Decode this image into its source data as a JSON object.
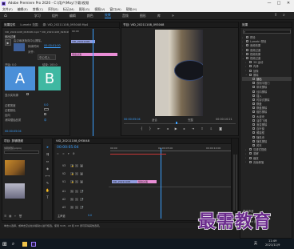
{
  "window": {
    "title": "Adobe Premiere Pro 2020 - C:\\用户\\Moy\\下载\\视频",
    "minimize": "—",
    "maximize": "□",
    "close": "✕"
  },
  "menu": [
    "文件(F)",
    "编辑(E)",
    "剪辑(C)",
    "序列(S)",
    "标记(M)",
    "图形(G)",
    "视图(V)",
    "窗口(W)",
    "帮助(H)"
  ],
  "workspaces": [
    "学习",
    "组件",
    "编辑",
    "颜色",
    "效果",
    "音频",
    "图形",
    "库"
  ],
  "active_workspace": "效果",
  "left_panel": {
    "tabs": [
      "效果控件",
      "Lumetri 范围",
      "源: VID_20211108_093048 Mp4"
    ],
    "clip_name": "VID_20211108_093048.mp4 * VID_20211108_093048",
    "effect_name": "划出过渡",
    "transition_desc": "由边缘逐渐向中心擦除。",
    "duration_label": "持续时间",
    "duration_value": "00:00:01:00",
    "alignment_label": "对齐:",
    "alignment_value": "中心切入",
    "start_label": "开始: 0.0",
    "end_label": "结束: 100.0",
    "a_label": "A",
    "b_label": "B",
    "show_actual": "显示实际源",
    "border_width": "边框宽度",
    "border_color": "边框颜色",
    "reverse": "反向",
    "antialias": "消除锯齿品质",
    "antialias_value": "中",
    "mini_timeline": {
      "clip_name": "VID_20211108",
      "transition": "划出过渡",
      "ruler_time": "00:00"
    },
    "timecode": "00:00:05:04"
  },
  "program": {
    "tab": "节目: VID_20211108_093048",
    "timecode_left": "00:00:05:04",
    "fit": "适合",
    "quality": "完整",
    "timecode_right": "00:00:10:21"
  },
  "effects_panel": {
    "tab": "效果",
    "items": [
      {
        "label": "预设",
        "indent": 0,
        "arrow": "›"
      },
      {
        "label": "Lumetri 预设",
        "indent": 0,
        "arrow": "›"
      },
      {
        "label": "音频效果",
        "indent": 0,
        "arrow": "›"
      },
      {
        "label": "音频过渡",
        "indent": 0,
        "arrow": "›"
      },
      {
        "label": "视频效果",
        "indent": 0,
        "arrow": "›"
      },
      {
        "label": "视频过渡",
        "indent": 0,
        "arrow": "⌄"
      },
      {
        "label": "3D 运动",
        "indent": 1,
        "arrow": "›"
      },
      {
        "label": "内滑",
        "indent": 1,
        "arrow": "›"
      },
      {
        "label": "划像",
        "indent": 1,
        "arrow": "›"
      },
      {
        "label": "擦除",
        "indent": 1,
        "arrow": "⌄"
      },
      {
        "label": "划出",
        "indent": 2,
        "arrow": "",
        "selected": true
      },
      {
        "label": "双侧平推门",
        "indent": 2,
        "arrow": ""
      },
      {
        "label": "带状擦除",
        "indent": 2,
        "arrow": ""
      },
      {
        "label": "径向擦除",
        "indent": 2,
        "arrow": ""
      },
      {
        "label": "插入",
        "indent": 2,
        "arrow": ""
      },
      {
        "label": "时钟式擦除",
        "indent": 2,
        "arrow": ""
      },
      {
        "label": "棋盘",
        "indent": 2,
        "arrow": ""
      },
      {
        "label": "棋盘擦除",
        "indent": 2,
        "arrow": ""
      },
      {
        "label": "楔形擦除",
        "indent": 2,
        "arrow": ""
      },
      {
        "label": "水波块",
        "indent": 2,
        "arrow": ""
      },
      {
        "label": "油漆飞溅",
        "indent": 2,
        "arrow": ""
      },
      {
        "label": "渐变擦除",
        "indent": 2,
        "arrow": ""
      },
      {
        "label": "百叶窗",
        "indent": 2,
        "arrow": ""
      },
      {
        "label": "螺旋框",
        "indent": 2,
        "arrow": ""
      },
      {
        "label": "随机块",
        "indent": 2,
        "arrow": ""
      },
      {
        "label": "随机擦除",
        "indent": 2,
        "arrow": ""
      },
      {
        "label": "风车",
        "indent": 2,
        "arrow": ""
      },
      {
        "label": "沉浸式视频",
        "indent": 1,
        "arrow": "›"
      },
      {
        "label": "溶解",
        "indent": 1,
        "arrow": "›"
      },
      {
        "label": "缩放",
        "indent": 1,
        "arrow": "›"
      },
      {
        "label": "页面剥落",
        "indent": 1,
        "arrow": "›"
      }
    ],
    "basic_sound": "基本声音",
    "lumetri_color": "Lumetri 颜色"
  },
  "project_panel": {
    "tab": "项目: 剪辑视频",
    "items_label": "项目",
    "file_name": "剪辑视频.prproj"
  },
  "timeline": {
    "tab": "VID_20211108_093048",
    "timecode": "00:00:05:04",
    "ruler_left": "00:00",
    "ruler_mid": "00:00:05:00",
    "ruler_right": "00:00:10:00",
    "tracks": [
      "V3",
      "V2",
      "V1",
      "A1",
      "A2",
      "A3"
    ],
    "master": "主声道",
    "master_value": "0.0",
    "clip_name": "VID_20211108",
    "transition_clip": "划出过渡"
  },
  "status_text": "单击以选择，或单击空白处并拖动以进行框选。使用 Shift、Alt 和 Ctrl 键可获得其他选项。",
  "taskbar": {
    "time": "11:49",
    "date": "2021/11/9",
    "lang": "英"
  },
  "watermark": "最需教育",
  "colors": {
    "accent": "#3aa0ff",
    "clip_blue": "#8f9bdc",
    "clip_pink": "#e98ed6",
    "ab_blue": "#4a8fd8",
    "ab_green": "#3fb8a2"
  }
}
